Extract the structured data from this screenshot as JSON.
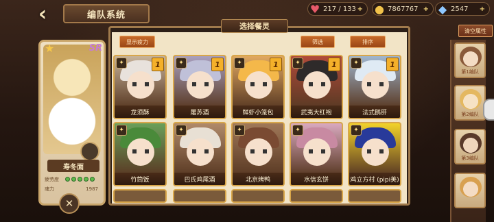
{
  "header": {
    "back_icon": "back-arrow-icon",
    "title": "编队系统"
  },
  "resources": {
    "stamina": {
      "icon": "heart-icon",
      "value": "217 / 133",
      "add": "+"
    },
    "gold": {
      "icon": "coin-icon",
      "value": "7867767",
      "add": "+"
    },
    "gems": {
      "icon": "diamond-icon",
      "value": "2547",
      "add": "+"
    }
  },
  "left_panel": {
    "rank": "SR",
    "name": "寿冬面",
    "row1_label": "疲劳度",
    "row2_label": "魂力",
    "row2_value": "1987",
    "craft_icon": "crossed-utensils-icon"
  },
  "modal": {
    "title": "选择餐灵",
    "buttons": {
      "fatigue": "显示疲力",
      "filter": "筛选",
      "sort": "排序"
    }
  },
  "cards": [
    {
      "name": "龙须酥",
      "level": "1",
      "hair": "#e8e2dc",
      "bg": "#c7b39a"
    },
    {
      "name": "屠苏酒",
      "level": "1",
      "hair": "#bfc0d8",
      "bg": "#a9a0bf"
    },
    {
      "name": "鲜虾小笼包",
      "level": "1",
      "hair": "#f4b84a",
      "bg": "#e0a860"
    },
    {
      "name": "武夷大红袍",
      "level": "1",
      "hair": "#2e2a2a",
      "bg": "#b04a3a"
    },
    {
      "name": "法式鹅肝",
      "level": "1",
      "hair": "#dfeaf4",
      "bg": "#9fb6cf"
    },
    {
      "name": "竹筒饭",
      "level": "",
      "hair": "#4a8a3a",
      "bg": "#6aa05a"
    },
    {
      "name": "巴氏鸡尾酒",
      "level": "",
      "hair": "#e8e0d4",
      "bg": "#b08a6a"
    },
    {
      "name": "北京烤鸭",
      "level": "",
      "hair": "#7a4a32",
      "bg": "#a07858"
    },
    {
      "name": "水信玄饼",
      "level": "",
      "hair": "#c88aa2",
      "bg": "#d9a9bf"
    },
    {
      "name": "鸡立方村 (pipi美)",
      "level": "",
      "hair": "#283a9a",
      "bg": "#f2d22a"
    }
  ],
  "sidebar": {
    "clear_label": "清空属性",
    "slots": [
      {
        "label": "第1编队"
      },
      {
        "label": "第2编队"
      },
      {
        "label": "第3编队"
      },
      {
        "label": ""
      }
    ]
  }
}
